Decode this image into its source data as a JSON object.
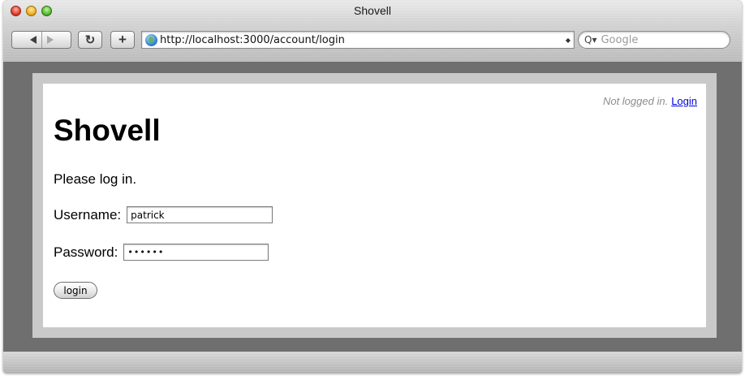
{
  "window": {
    "title": "Shovell"
  },
  "toolbar": {
    "reload_glyph": "↻",
    "add_glyph": "+",
    "url": "http://localhost:3000/account/login",
    "search_placeholder": "Google",
    "search_icon_glyph": "Q▾"
  },
  "page": {
    "status_text": "Not logged in.",
    "login_link": "Login",
    "site_title": "Shovell",
    "prompt": "Please log in.",
    "form": {
      "username_label": "Username:",
      "username_value": "patrick",
      "password_label": "Password:",
      "password_value": "••••••",
      "submit_label": "login"
    }
  },
  "colors": {
    "link": "#0000dd",
    "status_text": "#8d8d8d",
    "window_background": "#6f6f6f"
  }
}
